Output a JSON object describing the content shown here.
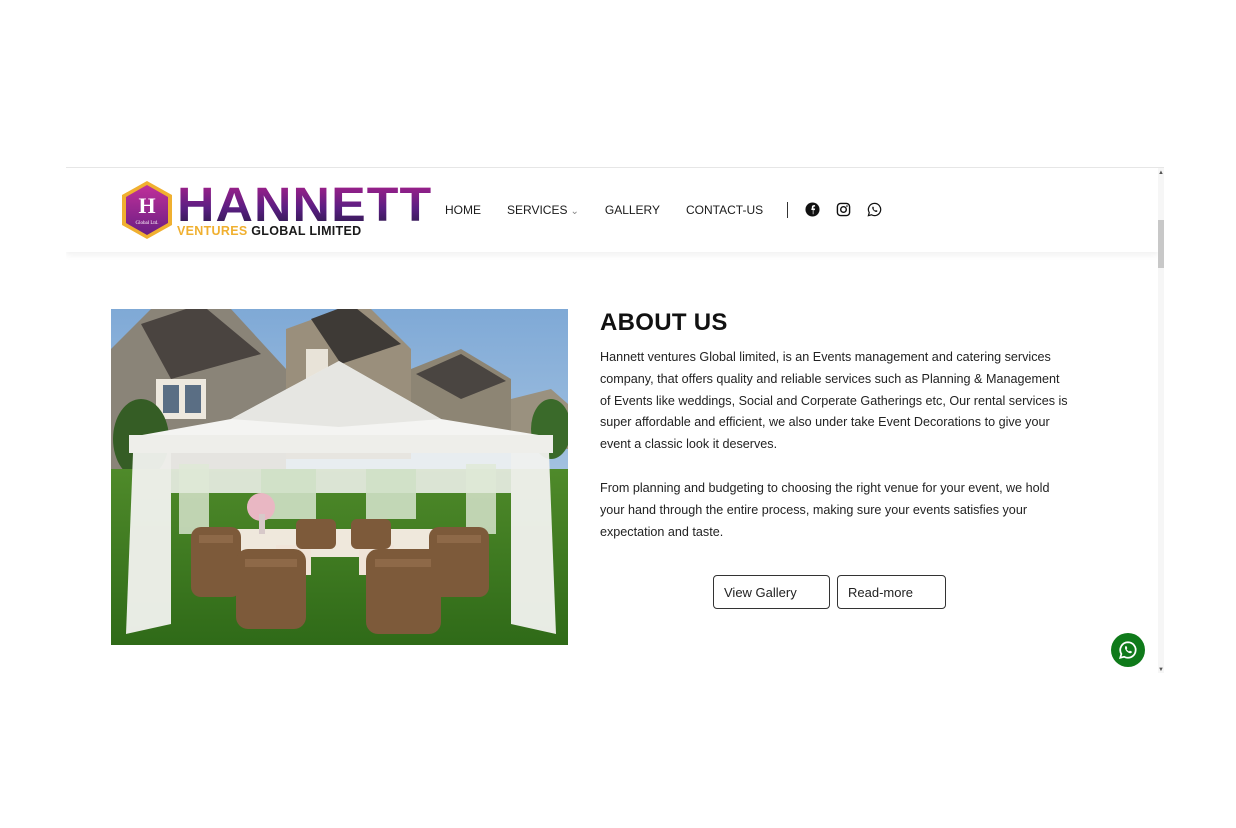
{
  "brand": {
    "hex_letter": "H",
    "hex_small": "Global Ltd.",
    "name": "HANNETT",
    "sub_highlight": "VENTURES",
    "sub_rest": "GLOBAL LIMITED"
  },
  "nav": {
    "items": [
      {
        "label": "HOME"
      },
      {
        "label": "SERVICES"
      },
      {
        "label": "GALLERY"
      },
      {
        "label": "CONTACT-US"
      }
    ]
  },
  "social": [
    "facebook-icon",
    "instagram-icon",
    "whatsapp-icon"
  ],
  "about": {
    "title": "ABOUT US",
    "para1": "Hannett ventures Global limited, is an Events management and catering services company, that offers quality and reliable services such as Planning & Management of Events like weddings, Social and Corperate Gatherings etc, Our rental services is super affordable and efficient, we also under take Event Decorations to give your event a classic look it deserves.",
    "para2": "From planning and budgeting to choosing the right venue for your event, we hold your hand through the entire process, making sure your events satisfies your expectation and taste.",
    "btn_gallery": "View Gallery",
    "btn_read": "Read-more"
  },
  "colors": {
    "brand_purple": "#7a1e8a",
    "brand_gold": "#f0b030",
    "whatsapp_green": "#0f7a1a"
  }
}
